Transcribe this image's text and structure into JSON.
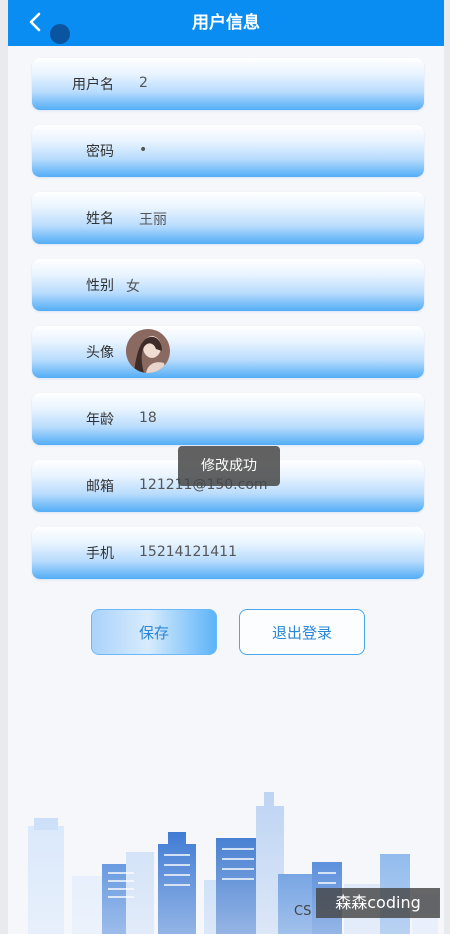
{
  "header": {
    "title": "用户信息",
    "back_icon": "chevron-left-icon",
    "color": "#0a8df2"
  },
  "fields": [
    {
      "label": "用户名",
      "value": "2"
    },
    {
      "label": "密码",
      "value": "•"
    },
    {
      "label": "姓名",
      "value": "王丽"
    },
    {
      "label": "性别",
      "value": "女"
    },
    {
      "label": "头像",
      "value": ""
    },
    {
      "label": "年龄",
      "value": "18"
    },
    {
      "label": "邮箱",
      "value": "121211@150.com"
    },
    {
      "label": "手机",
      "value": "15214121411"
    }
  ],
  "toast": "修改成功",
  "buttons": {
    "save": "保存",
    "logout": "退出登录"
  },
  "watermark": {
    "text": "森森coding",
    "prefix": "CS"
  }
}
